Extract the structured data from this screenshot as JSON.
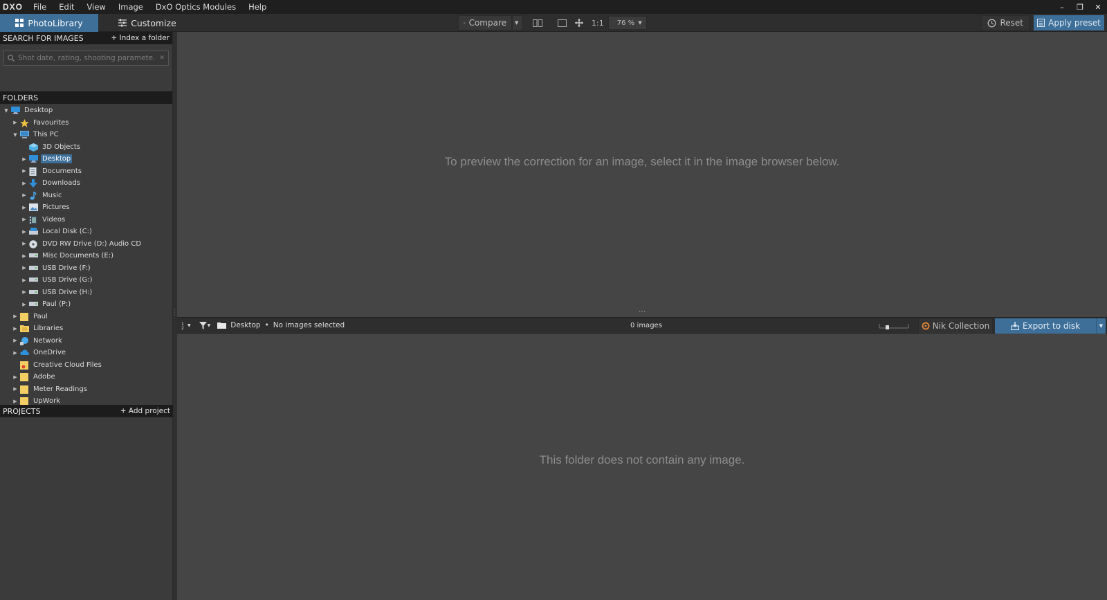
{
  "app": {
    "logo_text": "DXO"
  },
  "menu": [
    "File",
    "Edit",
    "View",
    "Image",
    "DxO Optics Modules",
    "Help"
  ],
  "window_controls": {
    "minimize": "–",
    "restore": "❐",
    "close": "✕"
  },
  "toolbar": {
    "tab_photolibrary": "PhotoLibrary",
    "tab_customize": "Customize",
    "compare_label": "Compare",
    "one_to_one": "1:1",
    "zoom": "76 %",
    "reset_label": "Reset",
    "apply_preset_label": "Apply preset"
  },
  "search": {
    "header": "SEARCH FOR IMAGES",
    "index_folder": "+ Index a folder",
    "placeholder": "Shot date, rating, shooting paramete..."
  },
  "folders": {
    "header": "FOLDERS",
    "items": [
      {
        "label": "Desktop",
        "level": 0,
        "arrow": "down",
        "icon": "desktop-icon",
        "selected": false
      },
      {
        "label": "Favourites",
        "level": 1,
        "arrow": "right",
        "icon": "star-icon",
        "selected": false
      },
      {
        "label": "This PC",
        "level": 1,
        "arrow": "down",
        "icon": "computer-icon",
        "selected": false
      },
      {
        "label": "3D Objects",
        "level": 2,
        "arrow": "none",
        "icon": "cube-icon",
        "selected": false
      },
      {
        "label": "Desktop",
        "level": 2,
        "arrow": "right",
        "icon": "desktop-icon",
        "selected": true
      },
      {
        "label": "Documents",
        "level": 2,
        "arrow": "right",
        "icon": "document-icon",
        "selected": false
      },
      {
        "label": "Downloads",
        "level": 2,
        "arrow": "right",
        "icon": "download-icon",
        "selected": false
      },
      {
        "label": "Music",
        "level": 2,
        "arrow": "right",
        "icon": "music-icon",
        "selected": false
      },
      {
        "label": "Pictures",
        "level": 2,
        "arrow": "right",
        "icon": "pictures-icon",
        "selected": false
      },
      {
        "label": "Videos",
        "level": 2,
        "arrow": "right",
        "icon": "video-icon",
        "selected": false
      },
      {
        "label": "Local Disk (C:)",
        "level": 2,
        "arrow": "right",
        "icon": "disk-icon",
        "selected": false
      },
      {
        "label": "DVD RW Drive (D:) Audio CD",
        "level": 2,
        "arrow": "right",
        "icon": "cd-icon",
        "selected": false
      },
      {
        "label": "Misc Documents (E:)",
        "level": 2,
        "arrow": "right",
        "icon": "drive-icon",
        "selected": false
      },
      {
        "label": "USB Drive (F:)",
        "level": 2,
        "arrow": "right",
        "icon": "drive-icon",
        "selected": false
      },
      {
        "label": "USB Drive (G:)",
        "level": 2,
        "arrow": "right",
        "icon": "drive-icon",
        "selected": false
      },
      {
        "label": "USB Drive (H:)",
        "level": 2,
        "arrow": "right",
        "icon": "drive-icon",
        "selected": false
      },
      {
        "label": "Paul (P:)",
        "level": 2,
        "arrow": "right",
        "icon": "drive-icon",
        "selected": false
      },
      {
        "label": "Paul",
        "level": 1,
        "arrow": "right",
        "icon": "folder-icon",
        "selected": false
      },
      {
        "label": "Libraries",
        "level": 1,
        "arrow": "right",
        "icon": "libraries-icon",
        "selected": false
      },
      {
        "label": "Network",
        "level": 1,
        "arrow": "right",
        "icon": "network-icon",
        "selected": false
      },
      {
        "label": "OneDrive",
        "level": 1,
        "arrow": "right",
        "icon": "cloud-icon",
        "selected": false
      },
      {
        "label": "Creative Cloud Files",
        "level": 1,
        "arrow": "none",
        "icon": "cc-folder-icon",
        "selected": false
      },
      {
        "label": "Adobe",
        "level": 1,
        "arrow": "right",
        "icon": "folder-icon",
        "selected": false
      },
      {
        "label": "Meter Readings",
        "level": 1,
        "arrow": "right",
        "icon": "folder-icon",
        "selected": false
      },
      {
        "label": "UpWork",
        "level": 1,
        "arrow": "right",
        "icon": "folder-icon",
        "selected": false
      }
    ]
  },
  "projects": {
    "header": "PROJECTS",
    "add_project": "+ Add project"
  },
  "preview": {
    "message": "To preview the correction for an image, select it in the image browser below."
  },
  "browser_bar": {
    "current_folder": "Desktop",
    "separator": "•",
    "selection_status": "No images selected",
    "image_count": "0 images",
    "nik_label": "Nik Collection",
    "export_label": "Export to disk"
  },
  "browser": {
    "message": "This folder does not contain any image."
  },
  "colors": {
    "accent": "#3d6f99",
    "panel_header": "#1c1c1c",
    "background": "#454545"
  }
}
